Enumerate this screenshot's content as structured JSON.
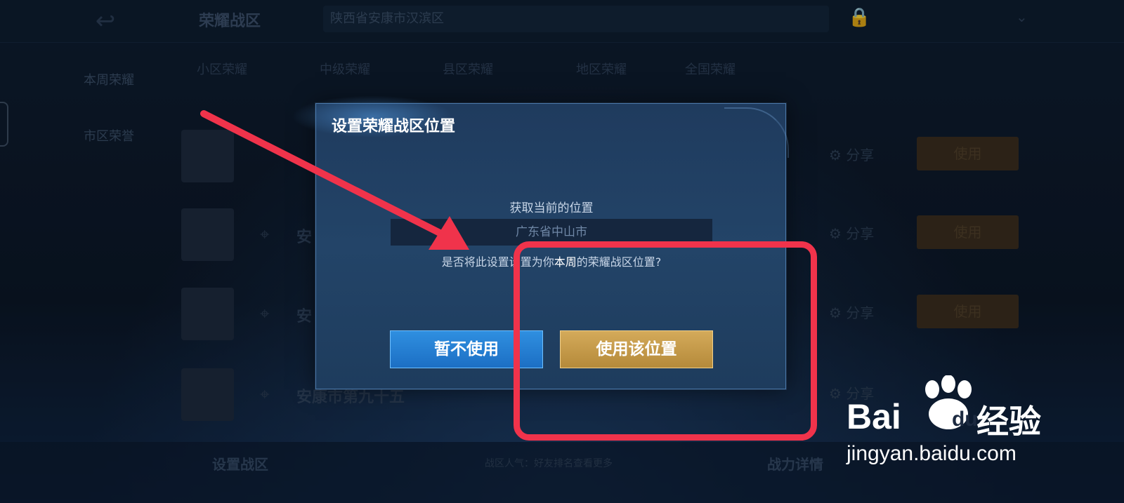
{
  "background": {
    "top_title": "荣耀战区",
    "top_location": "陕西省安康市汉滨区",
    "side_items": [
      "本周荣耀",
      "市区荣誉"
    ],
    "tabs": [
      "小区荣耀",
      "中级荣耀",
      "县区荣耀",
      "地区荣耀",
      "全国荣耀"
    ],
    "rows": [
      {
        "name": "",
        "share": "分享",
        "use": "使用"
      },
      {
        "name": "安",
        "share": "分享",
        "use": "使用"
      },
      {
        "name": "安",
        "share": "分享",
        "use": "使用"
      },
      {
        "name": "安康市第九十五",
        "share": "分享",
        "use": ""
      }
    ],
    "footer_left": "设置战区",
    "footer_mid": "战区人气：好友排名查看更多",
    "footer_right": "战力详情"
  },
  "dialog": {
    "title": "设置荣耀战区位置",
    "subtitle": "获取当前的位置",
    "location_value": "广东省中山市",
    "question_pre": "是否将此设置设置为你",
    "question_highlight": "本周",
    "question_post": "的荣耀战区位置?",
    "cancel_label": "暂不使用",
    "confirm_label": "使用该位置"
  },
  "watermark": {
    "brand_bai": "Bai",
    "brand_du": "du",
    "brand_jy": "经验",
    "url": "jingyan.baidu.com"
  },
  "colors": {
    "annotation_red": "#f0334b",
    "cancel_blue": "#2f8fe0",
    "confirm_gold": "#d4aa5a",
    "dialog_bg": "#234468"
  },
  "icons": {
    "back": "back-arrow-icon",
    "lock": "lock-icon",
    "chevron": "chevron-down-icon",
    "share": "gear-share-icon",
    "pin": "location-pin-icon",
    "paw": "baidu-paw-icon"
  }
}
